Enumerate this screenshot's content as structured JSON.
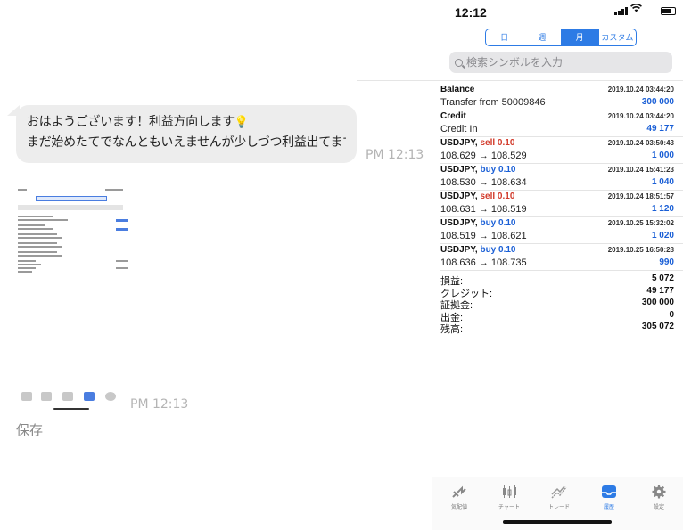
{
  "chat": {
    "message_line1": "おはようございます！利益方向します",
    "message_line2": "まだ始めたてでなんともいえませんが少しづつ利益出てます",
    "time1": "PM 12:13",
    "time2": "PM 12:13",
    "save_label": "保存"
  },
  "status": {
    "time": "12:12"
  },
  "period_tabs": [
    {
      "label": "日"
    },
    {
      "label": "週"
    },
    {
      "label": "月",
      "selected": true
    },
    {
      "label": "カスタム"
    }
  ],
  "search": {
    "placeholder": "検索シンボルを入力"
  },
  "history": [
    {
      "title": "Balance",
      "side": "",
      "date": "2019.10.24 03:44:20",
      "detail": "Transfer from 50009846",
      "amount": "300 000"
    },
    {
      "title": "Credit",
      "side": "",
      "date": "2019.10.24 03:44:20",
      "detail": "Credit In",
      "amount": "49 177"
    },
    {
      "title": "USDJPY,",
      "side": "sell 0.10",
      "date": "2019.10.24 03:50:43",
      "detail": "108.629 → 108.529",
      "amount": "1 000"
    },
    {
      "title": "USDJPY,",
      "side": "buy 0.10",
      "date": "2019.10.24 15:41:23",
      "detail": "108.530 → 108.634",
      "amount": "1 040"
    },
    {
      "title": "USDJPY,",
      "side": "sell 0.10",
      "date": "2019.10.24 18:51:57",
      "detail": "108.631 → 108.519",
      "amount": "1 120"
    },
    {
      "title": "USDJPY,",
      "side": "buy 0.10",
      "date": "2019.10.25 15:32:02",
      "detail": "108.519 → 108.621",
      "amount": "1 020"
    },
    {
      "title": "USDJPY,",
      "side": "buy 0.10",
      "date": "2019.10.25 16:50:28",
      "detail": "108.636 → 108.735",
      "amount": "990"
    }
  ],
  "summary": [
    {
      "label": "損益:",
      "value": "5 072"
    },
    {
      "label": "クレジット:",
      "value": "49 177"
    },
    {
      "label": "証拠金:",
      "value": "300 000"
    },
    {
      "label": "出金:",
      "value": "0"
    },
    {
      "label": "残高:",
      "value": "305 072"
    }
  ],
  "tabbar": [
    {
      "label": "気配値",
      "icon": "quotes-icon"
    },
    {
      "label": "チャート",
      "icon": "chart-icon"
    },
    {
      "label": "トレード",
      "icon": "trade-icon"
    },
    {
      "label": "履歴",
      "icon": "history-icon",
      "selected": true
    },
    {
      "label": "設定",
      "icon": "settings-icon"
    }
  ],
  "colors": {
    "accent": "#2d7be5",
    "sell": "#d23a2a",
    "buy": "#1a5fd6"
  }
}
